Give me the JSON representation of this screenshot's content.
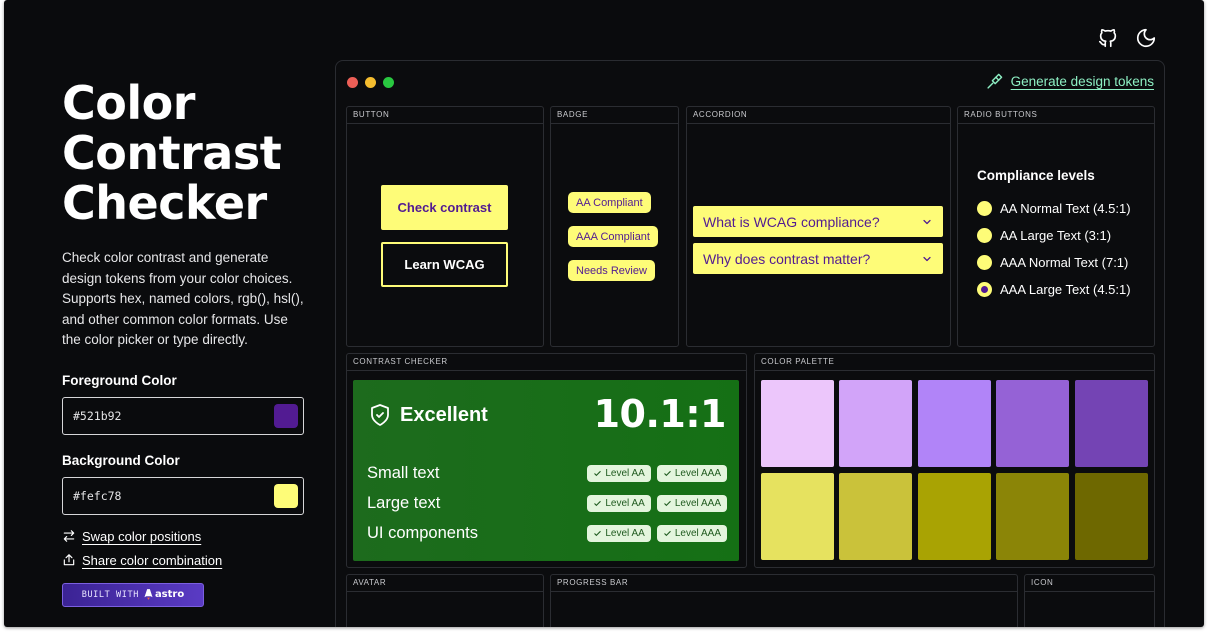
{
  "header": {
    "github_icon": "github-icon",
    "theme_icon": "moon-icon"
  },
  "left": {
    "title_lines": [
      "Color",
      "Contrast",
      "Checker"
    ],
    "description": "Check color contrast and generate design tokens from your color choices. Supports hex, named colors, rgb(), hsl(), and other common color formats. Use the color picker or type directly.",
    "foreground": {
      "label": "Foreground Color",
      "value": "#521b92",
      "color": "#521b92"
    },
    "background": {
      "label": "Background Color",
      "value": "#fefc78",
      "color": "#fefc78"
    },
    "swap_label": "Swap color positions",
    "share_label": "Share color combination",
    "built_with": "BUILT WITH",
    "astro": "astro"
  },
  "window": {
    "generate_label": "Generate design tokens",
    "dots": [
      "#ed5f57",
      "#f5bd2f",
      "#29c840"
    ]
  },
  "panels": {
    "button": {
      "title": "BUTTON",
      "primary": "Check contrast",
      "secondary": "Learn WCAG"
    },
    "badge": {
      "title": "BADGE",
      "items": [
        "AA Compliant",
        "AAA Compliant",
        "Needs Review"
      ]
    },
    "accordion": {
      "title": "ACCORDION",
      "items": [
        "What is WCAG compliance?",
        "Why does contrast matter?"
      ]
    },
    "radio": {
      "title": "RADIO BUTTONS",
      "heading": "Compliance levels",
      "options": [
        "AA Normal Text (4.5:1)",
        "AA Large Text (3:1)",
        "AAA Normal Text (7:1)",
        "AAA Large Text (4.5:1)"
      ],
      "selected_index": 3
    },
    "contrast": {
      "title": "CONTRAST CHECKER",
      "rating": "Excellent",
      "ratio": "10.1:1",
      "rows": [
        {
          "label": "Small text",
          "chips": [
            "Level AA",
            "Level AAA"
          ]
        },
        {
          "label": "Large text",
          "chips": [
            "Level AA",
            "Level AAA"
          ]
        },
        {
          "label": "UI components",
          "chips": [
            "Level AA",
            "Level AAA"
          ]
        }
      ]
    },
    "palette": {
      "title": "COLOR PALETTE",
      "row1": [
        "#ecc6fb",
        "#d2a4f9",
        "#b184f8",
        "#9562d6",
        "#7444b4"
      ],
      "row2": [
        "#e6e25f",
        "#cac23a",
        "#a9a303",
        "#8b8507",
        "#6e6800"
      ]
    },
    "avatar": {
      "title": "AVATAR"
    },
    "progress": {
      "title": "PROGRESS BAR"
    },
    "icon": {
      "title": "ICON"
    }
  }
}
